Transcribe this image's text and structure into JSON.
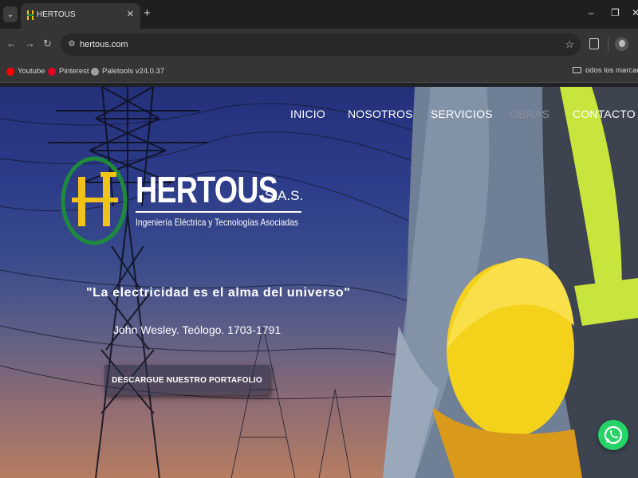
{
  "browser": {
    "tab": {
      "title": "HERTOUS"
    },
    "new_tab_label": "+",
    "window_controls": {
      "minimize": "–",
      "restore": "❐",
      "close": "✕"
    },
    "address_bar": {
      "url": "hertous.com"
    },
    "bookmarks": [
      {
        "label": "Youtube",
        "icon": "youtube-icon",
        "color": "#ff0000"
      },
      {
        "label": "Pinterest",
        "icon": "pinterest-icon",
        "color": "#e60023"
      },
      {
        "label": "Paletools v24.0.37",
        "icon": "globe-icon",
        "color": "#9e9e9e"
      }
    ],
    "bookmarks_right": "odos los marcador"
  },
  "site": {
    "nav": [
      {
        "label": "INICIO",
        "active": false
      },
      {
        "label": "NOSOTROS",
        "active": false
      },
      {
        "label": "SERVICIOS",
        "active": false
      },
      {
        "label": "OBRAS",
        "active": true
      },
      {
        "label": "CONTACTO",
        "active": false
      }
    ],
    "logo": {
      "name": "HERTOUS",
      "suffix": "S.A.S.",
      "tagline": "Ingeniería Eléctrica y Tecnologías Asociadas"
    },
    "hero": {
      "quote": "\"La electricidad es el alma del universo\"",
      "author": "John Wesley. Teólogo. 1703-1791",
      "cta": "DESCARGUE NUESTRO PORTAFOLIO"
    },
    "colors": {
      "logo_green": "#1f8a3c",
      "logo_yellow": "#f2c21b",
      "whatsapp_green": "#25d366",
      "nav_active": "#8a8d99"
    }
  }
}
